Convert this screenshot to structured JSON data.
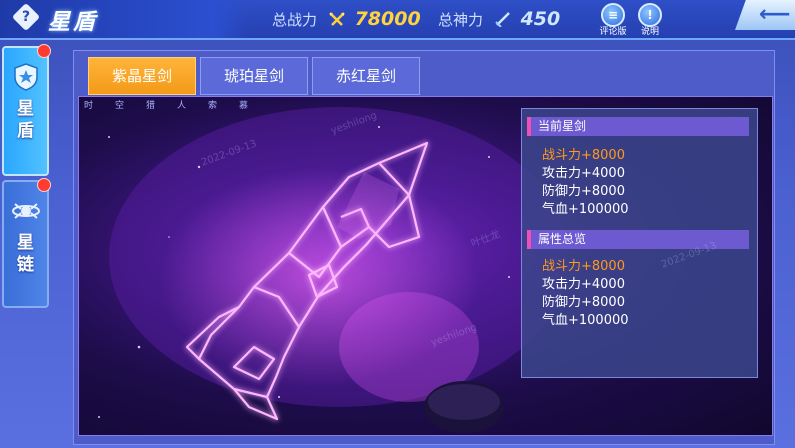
{
  "header": {
    "title": "星盾",
    "help_icon": "diamond-question-icon",
    "total_power_label": "总战力",
    "total_power_value": "78000",
    "total_god_label": "总神力",
    "total_god_value": "450",
    "review_label": "评论版",
    "explain_label": "说明",
    "back_icon": "back-arrow-icon"
  },
  "sidebar": {
    "items": [
      {
        "label": "星盾",
        "icon": "shield-star-icon",
        "active": true
      },
      {
        "label": "星链",
        "icon": "star-chain-icon",
        "active": false
      }
    ]
  },
  "tabs": [
    {
      "label": "紫晶星剑",
      "selected": true
    },
    {
      "label": "琥珀星剑",
      "selected": false
    },
    {
      "label": "赤红星剑",
      "selected": false
    }
  ],
  "stage": {
    "ruler_text": "时空猎人索慕"
  },
  "info": {
    "current_title": "当前星剑",
    "current_attrs": [
      "战斗力+8000",
      "攻击力+4000",
      "防御力+8000",
      "气血+100000"
    ],
    "total_title": "属性总览",
    "total_attrs": [
      "战斗力+8000",
      "攻击力+4000",
      "防御力+8000",
      "气血+100000"
    ]
  },
  "watermarks": [
    "yeshilong",
    "2022-09-13",
    "叶仕龙"
  ],
  "colors": {
    "highlight": "#ff9a1a",
    "active_tab": "#f39a18",
    "section_accent": "#f04fb8"
  }
}
